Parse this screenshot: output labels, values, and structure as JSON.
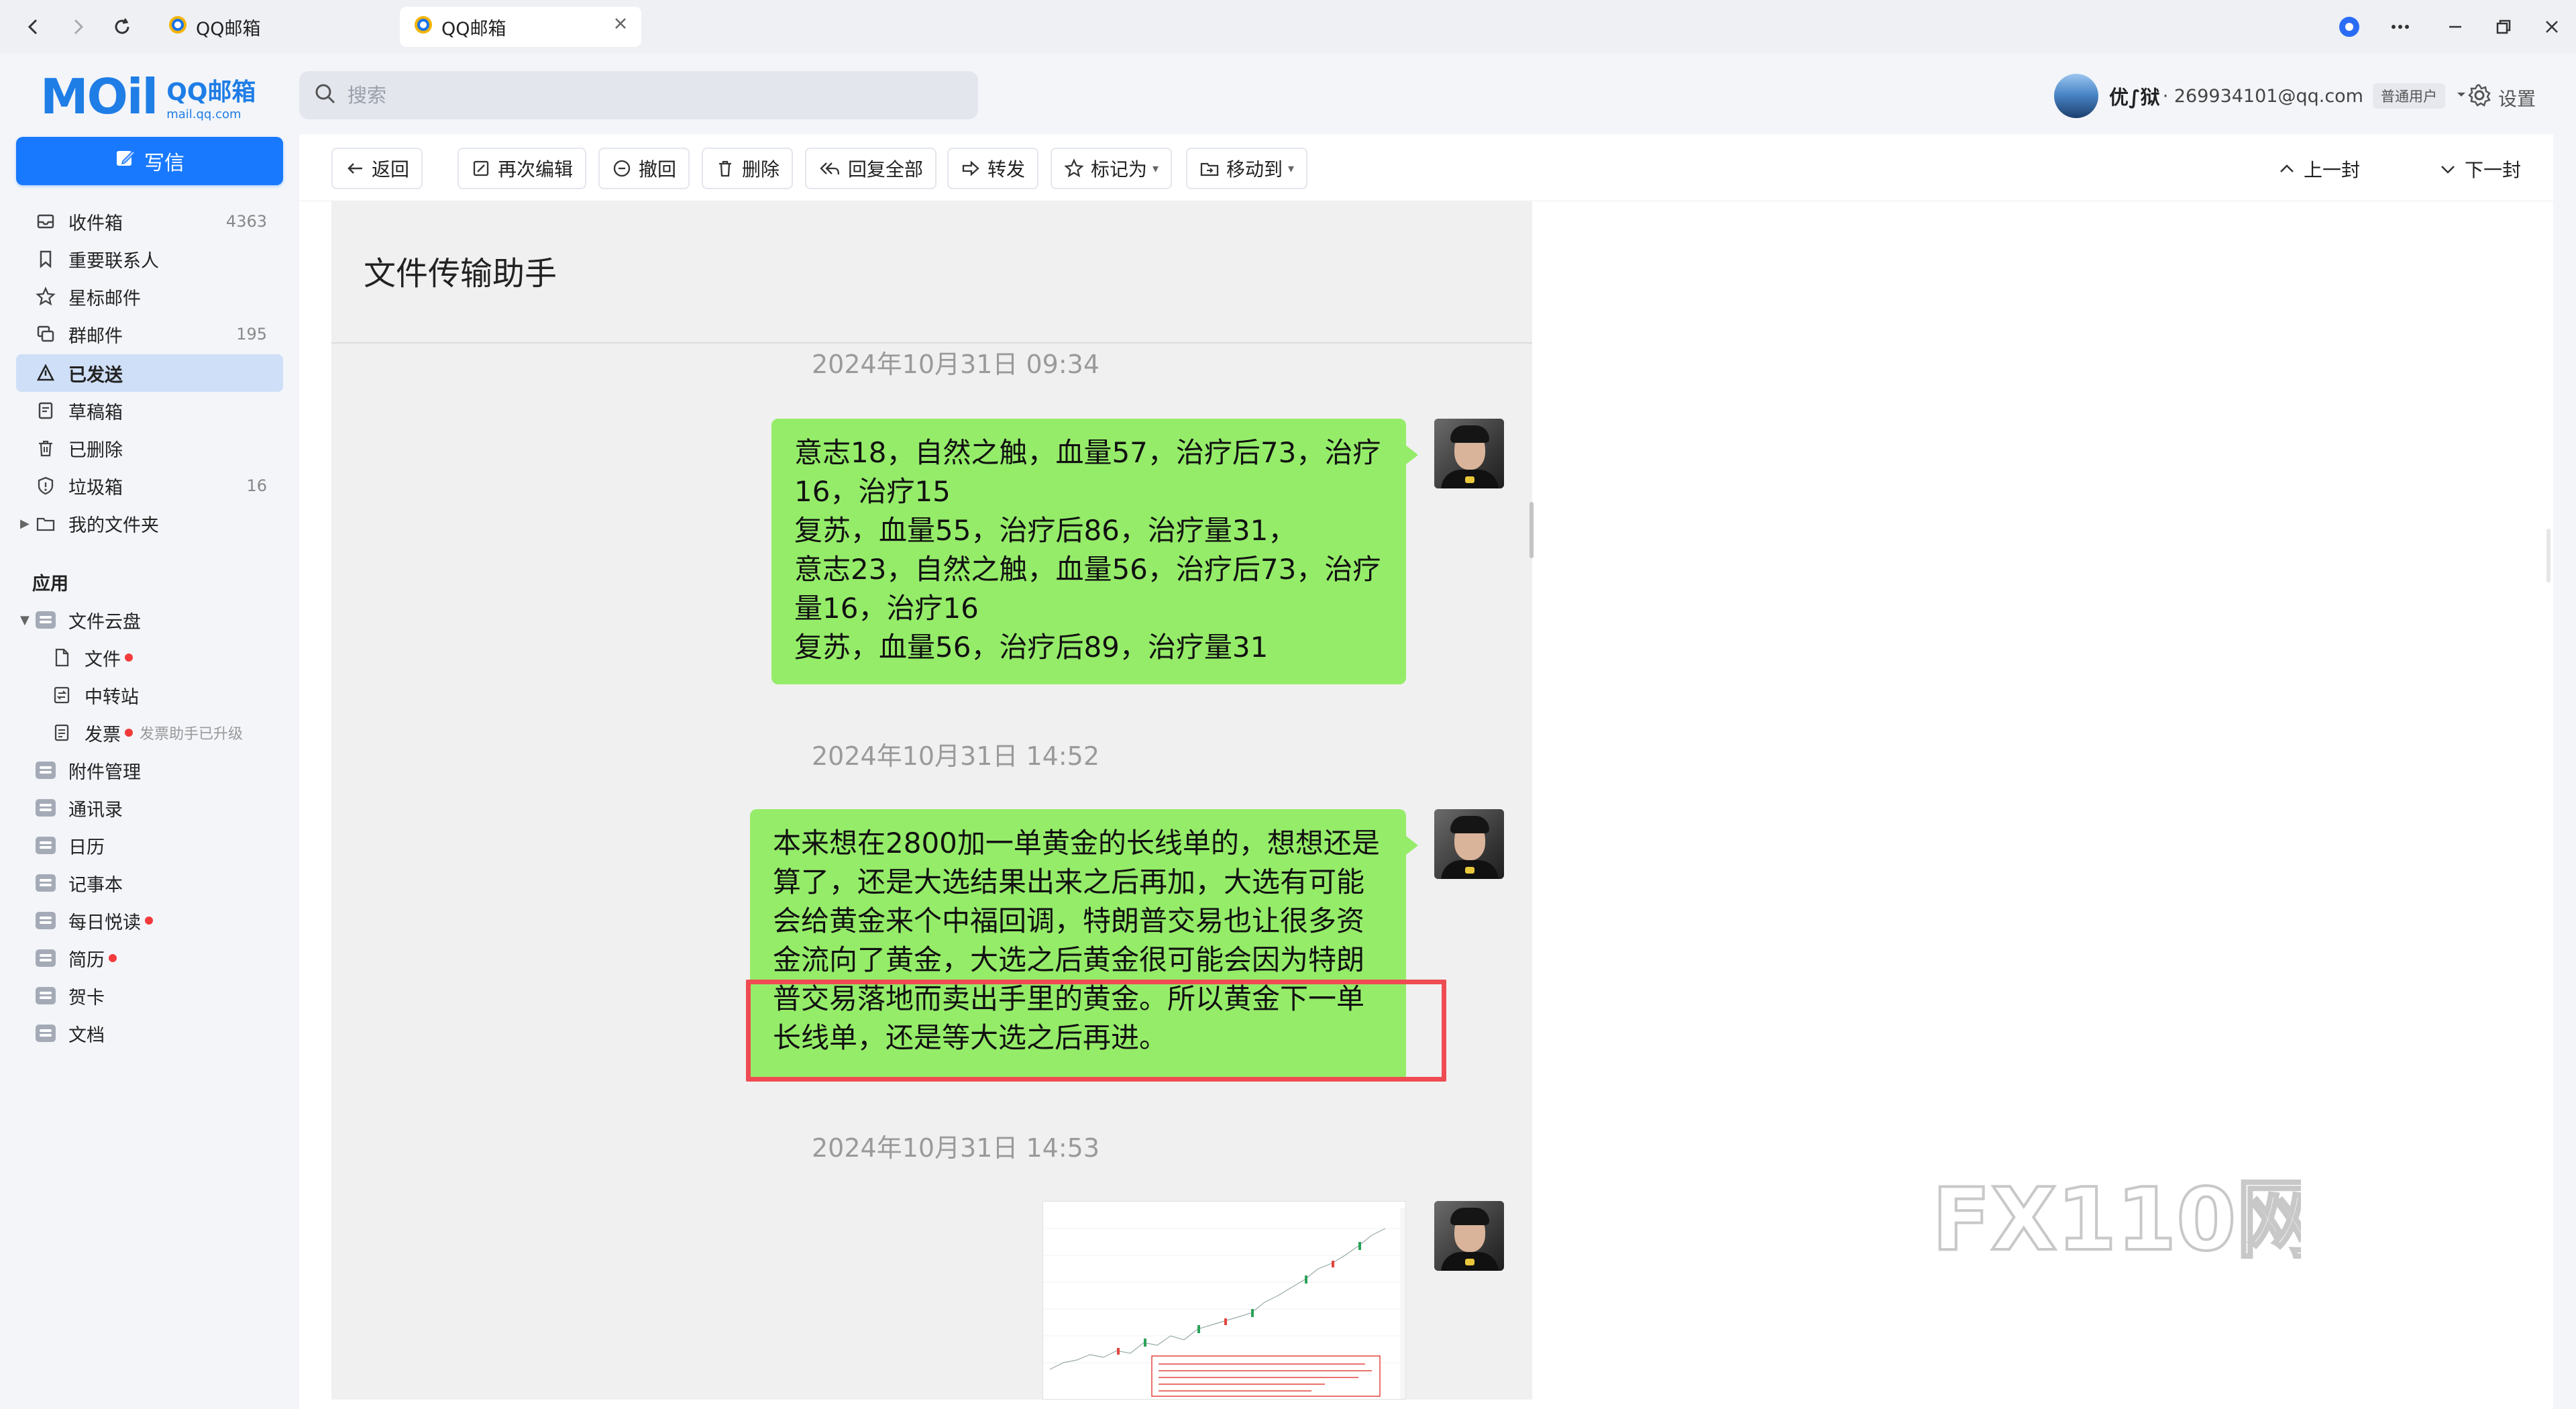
{
  "browser": {
    "tabs": [
      {
        "title": "QQ邮箱",
        "active": false
      },
      {
        "title": "QQ邮箱",
        "active": true
      }
    ]
  },
  "header": {
    "logo_word": "MOil",
    "logo_title": "QQ邮箱",
    "logo_domain": "mail.qq.com",
    "search_placeholder": "搜索",
    "account_name": "优∫狱",
    "account_email": "· 269934101@qq.com",
    "account_badge": "普通用户",
    "settings_label": "设置"
  },
  "sidebar": {
    "compose_label": "写信",
    "folders": [
      {
        "label": "收件箱",
        "count": "4363",
        "icon": "inbox-icon"
      },
      {
        "label": "重要联系人",
        "count": "",
        "icon": "bookmark-icon"
      },
      {
        "label": "星标邮件",
        "count": "",
        "icon": "star-icon"
      },
      {
        "label": "群邮件",
        "count": "195",
        "icon": "group-mail-icon"
      },
      {
        "label": "已发送",
        "count": "",
        "icon": "sent-icon",
        "active": true
      },
      {
        "label": "草稿箱",
        "count": "",
        "icon": "draft-icon"
      },
      {
        "label": "已删除",
        "count": "",
        "icon": "trash-icon"
      },
      {
        "label": "垃圾箱",
        "count": "16",
        "icon": "spam-shield-icon"
      },
      {
        "label": "我的文件夹",
        "count": "",
        "icon": "folder-icon"
      }
    ],
    "apps_heading": "应用",
    "cloud": {
      "label": "文件云盘",
      "children": [
        {
          "label": "文件",
          "dot": true
        },
        {
          "label": "中转站",
          "dot": false
        },
        {
          "label": "发票",
          "dot": true,
          "note": "发票助手已升级"
        }
      ]
    },
    "apps": [
      {
        "label": "附件管理",
        "dot": false
      },
      {
        "label": "通讯录",
        "dot": false
      },
      {
        "label": "日历",
        "dot": false
      },
      {
        "label": "记事本",
        "dot": false
      },
      {
        "label": "每日悦读",
        "dot": true
      },
      {
        "label": "简历",
        "dot": true
      },
      {
        "label": "贺卡",
        "dot": false
      },
      {
        "label": "文档",
        "dot": false
      }
    ]
  },
  "toolbar": {
    "back": "返回",
    "edit_again": "再次编辑",
    "recall": "撤回",
    "delete": "删除",
    "reply_all": "回复全部",
    "forward": "转发",
    "mark_as": "标记为",
    "move_to": "移动到",
    "prev": "上一封",
    "next": "下一封"
  },
  "chat": {
    "title": "文件传输助手",
    "messages": [
      {
        "time": "2024年10月31日 09:34",
        "lines": [
          "意志18，自然之触，血量57，治疗后73，治疗",
          "16，治疗15",
          "复苏，血量55，治疗后86，治疗量31，",
          "意志23，自然之触，血量56，治疗后73，治疗",
          "量16，治疗16",
          "复苏，血量56，治疗后89，治疗量31"
        ]
      },
      {
        "time": "2024年10月31日 14:52",
        "lines": [
          "本来想在2800加一单黄金的长线单的，想想还是",
          "算了，还是大选结果出来之后再加，大选有可能",
          "会给黄金来个中福回调，特朗普交易也让很多资",
          "金流向了黄金，大选之后黄金很可能会因为特朗",
          "普交易落地而卖出手里的黄金。所以黄金下一单",
          "长线单，还是等大选之后再进。"
        ]
      },
      {
        "time": "2024年10月31日 14:53"
      }
    ]
  },
  "watermark": "FX110网",
  "colors": {
    "accent": "#1879ff",
    "bubble": "#95ec69",
    "highlight": "#ef4b52",
    "active_folder": "#cfdff7"
  }
}
